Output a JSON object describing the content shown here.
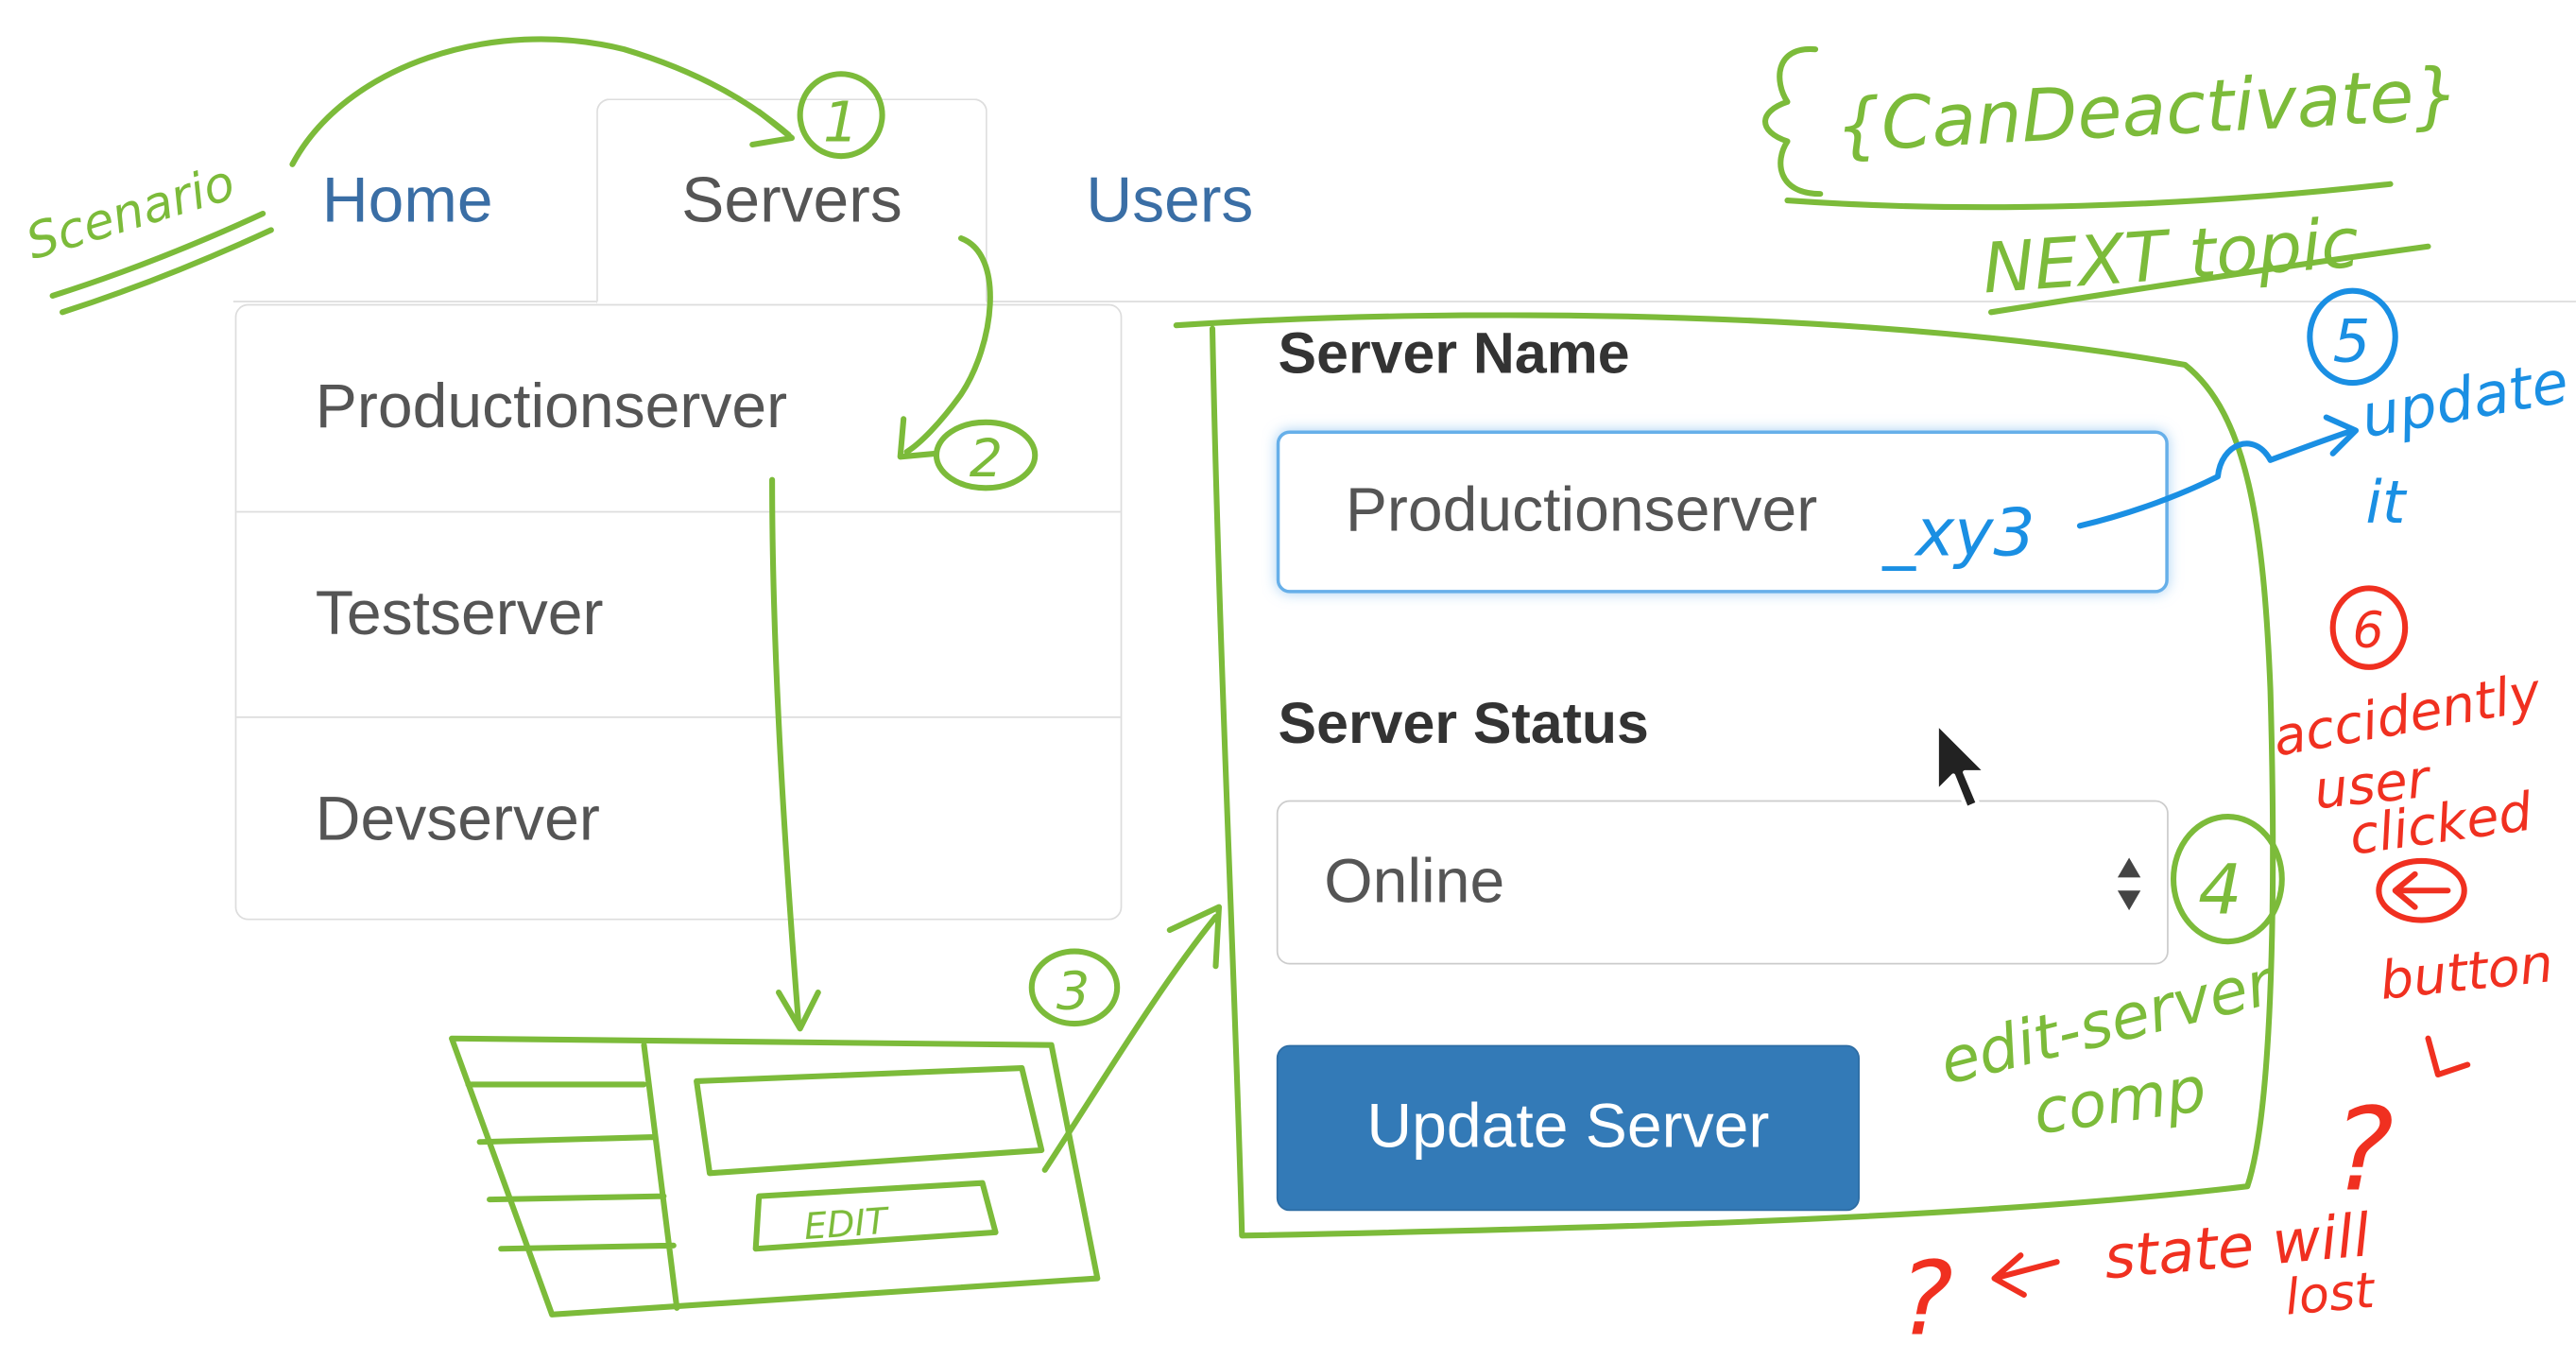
{
  "nav": {
    "tabs": [
      {
        "label": "Home",
        "active": false
      },
      {
        "label": "Servers",
        "active": true
      },
      {
        "label": "Users",
        "active": false
      }
    ]
  },
  "server_list": [
    "Productionserver",
    "Testserver",
    "Devserver"
  ],
  "form": {
    "name_label": "Server Name",
    "name_value": "Productionserver",
    "status_label": "Server Status",
    "status_value": "Online",
    "update_button": "Update Server"
  },
  "annotations": {
    "scenario": "Scenario",
    "can_deactivate": "{CanDeactivate}",
    "next_topic": "NEXT topic",
    "step1": "1",
    "step2": "2",
    "step3": "3",
    "step4": "4",
    "step5": "5",
    "step6": "6",
    "edit_label": "EDIT",
    "name_suffix": "_xy3",
    "update_it_1": "update",
    "update_it_2": "it",
    "edit_server_comp_1": "edit-server",
    "edit_server_comp_2": "comp",
    "accidently_1": "accidently",
    "accidently_2": "user",
    "accidently_3": "clicked",
    "accidently_4": "button",
    "state_lost_1": "state will",
    "state_lost_2": "lost",
    "q1": "?",
    "q2": "?"
  },
  "colors": {
    "ink_green": "#7cbb3a",
    "ink_blue": "#1a8fe3",
    "ink_red": "#f03020",
    "primary_button": "#337ab7",
    "link": "#3a6ea5"
  }
}
